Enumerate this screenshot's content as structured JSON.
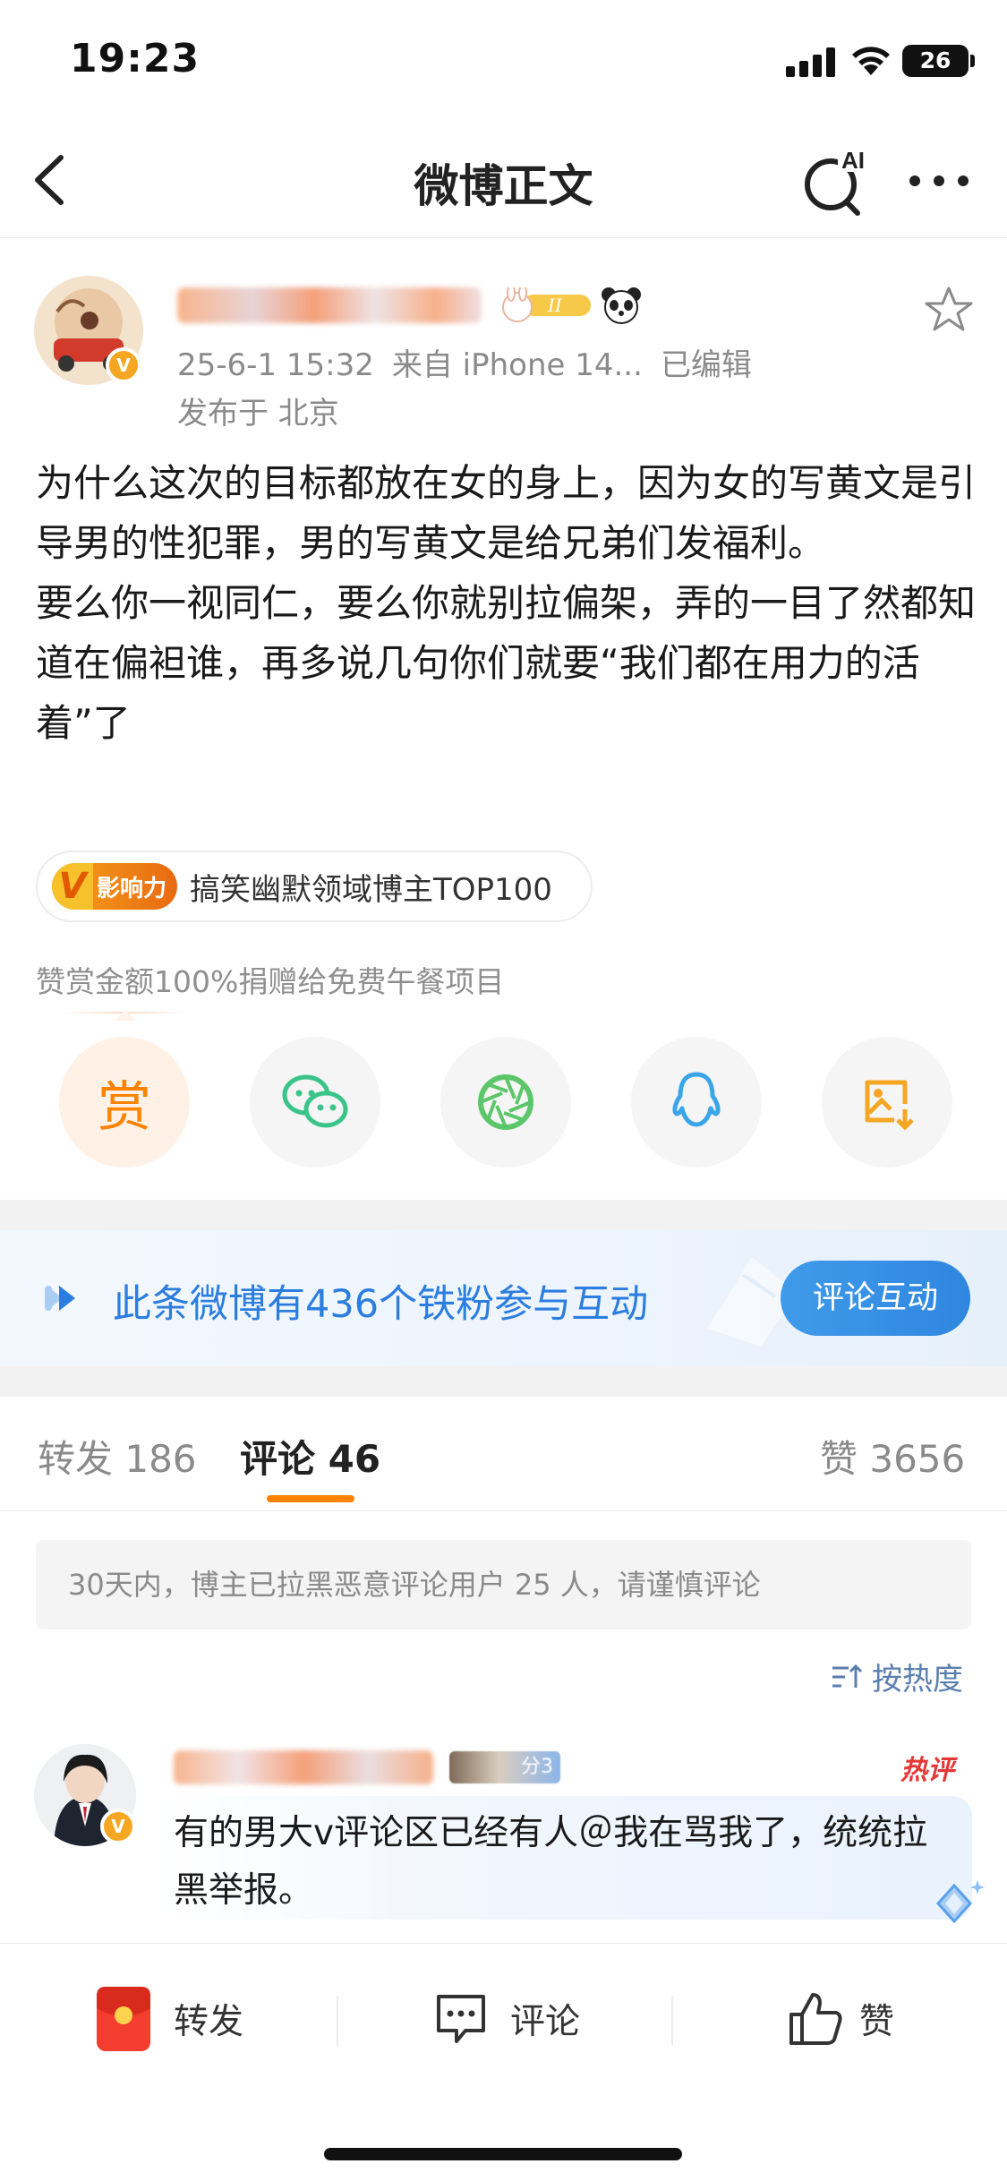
{
  "status_bar": {
    "time": "19:23",
    "battery": "26"
  },
  "header": {
    "title": "微博正文",
    "ai_label": "AI"
  },
  "post": {
    "meta_time": "25-6-1 15:32",
    "meta_source": "来自 iPhone 14...",
    "meta_edited": "已编辑",
    "location": "发布于 北京",
    "paragraphs": [
      "为什么这次的目标都放在女的身上，因为女的写黄文是引导男的性犯罪，男的写黄文是给兄弟们发福利。",
      "要么你一视同仁，要么你就别拉偏架，弄的一目了然都知道在偏袒谁，再多说几句你们就要“我们都在用力的活着”了"
    ],
    "influence_badge": "影响力",
    "influence_text": "搞笑幽默领域博主TOP100",
    "level_badge": "II"
  },
  "reward": {
    "note": "赞赏金额100%捐赠给免费午餐项目",
    "reward_label": "赏"
  },
  "fans_banner": {
    "text": "此条微博有436个铁粉参与互动",
    "button": "评论互动"
  },
  "tabs": {
    "repost": "转发 186",
    "comment": "评论 46",
    "like": "赞 3656"
  },
  "comments": {
    "notice": "30天内，博主已拉黑恶意评论用户 25 人，请谨慎评论",
    "sort_label": "按热度",
    "first": {
      "fan_level": "分3",
      "hot_tag": "热评",
      "text": "有的男大v评论区已经有人＠我在骂我了，统统拉黑举报。"
    }
  },
  "toolbar": {
    "repost": "转发",
    "comment": "评论",
    "like": "赞"
  },
  "colors": {
    "accent": "#ff8200",
    "link": "#2b7de0",
    "meta": "#8a8a8a"
  }
}
